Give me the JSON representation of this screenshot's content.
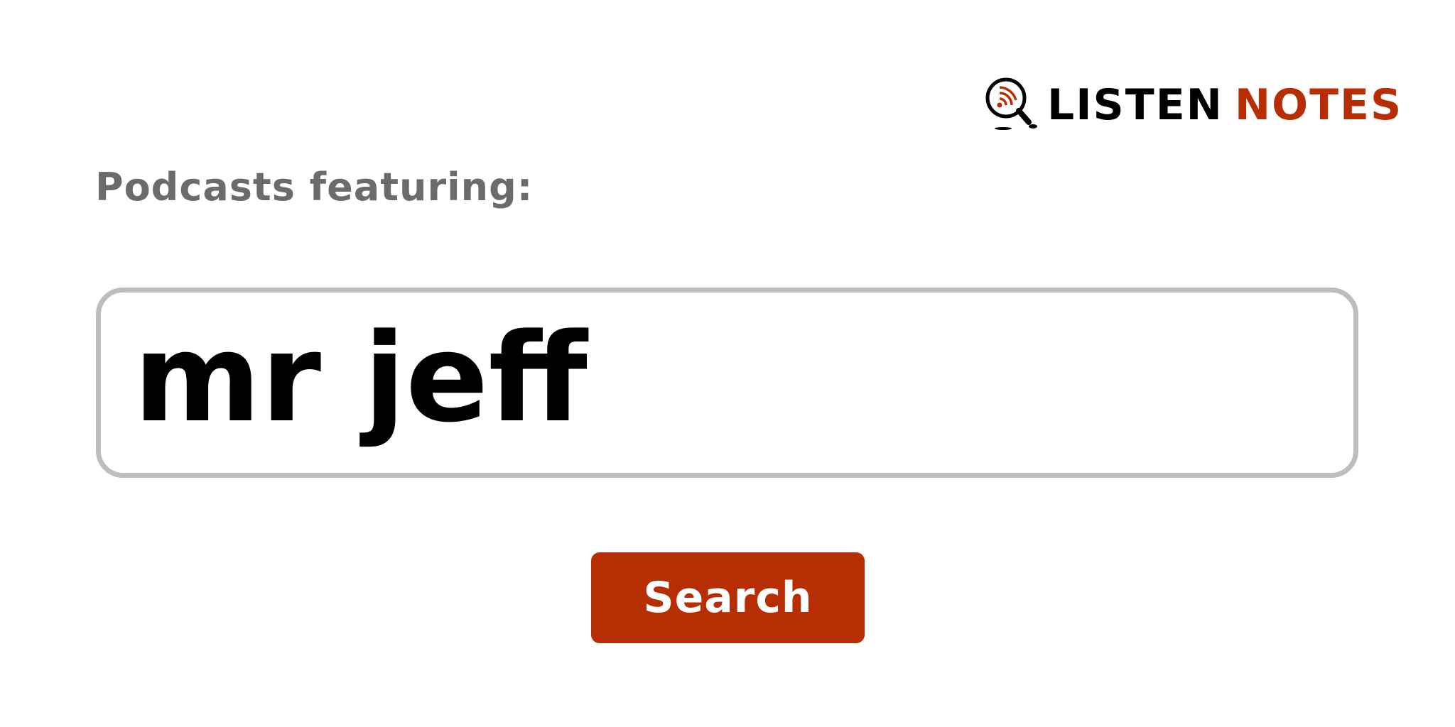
{
  "logo": {
    "word1": "LISTEN",
    "word2": "NOTES",
    "icon": "magnifier-podcast-icon",
    "colors": {
      "dark": "#000000",
      "accent": "#b82e04"
    }
  },
  "label": "Podcasts featuring:",
  "search": {
    "value": "mr jeff"
  },
  "button": {
    "label": "Search",
    "color": "#b82e04"
  }
}
